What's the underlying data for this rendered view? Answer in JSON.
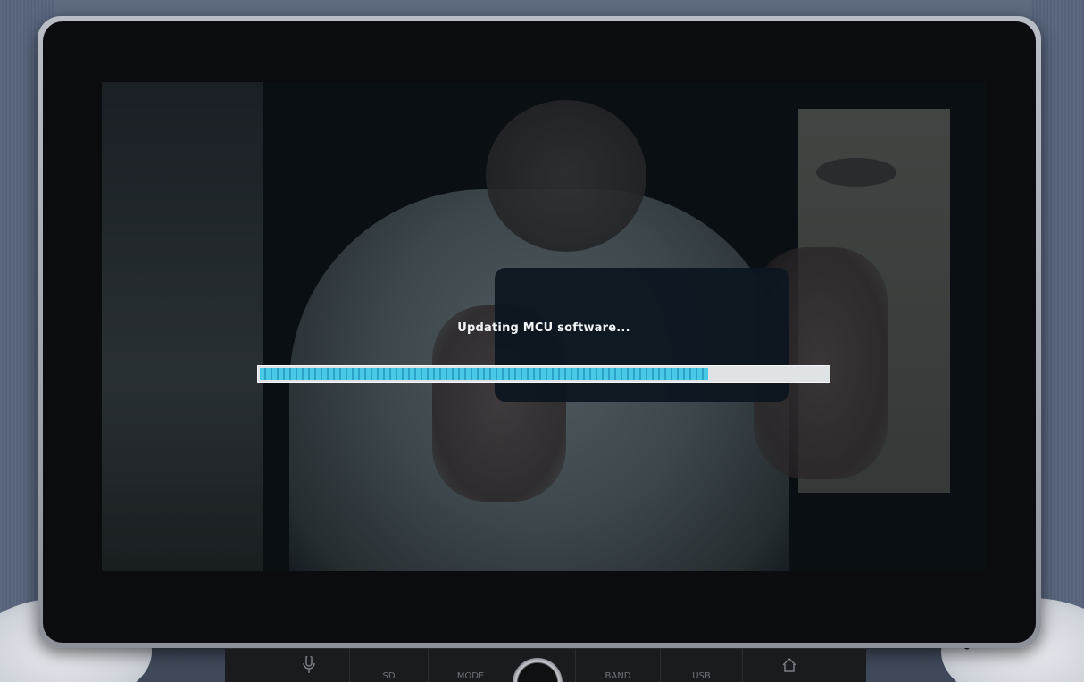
{
  "screen": {
    "status_text": "Updating MCU software...",
    "progress": 0.79,
    "progress_color": "#49c9e6"
  },
  "controls": {
    "mic_icon": "mic-icon",
    "sd_label": "SD",
    "mode_label": "MODE",
    "band_label": "BAND",
    "usb_label": "USB",
    "home_icon": "home-icon"
  }
}
